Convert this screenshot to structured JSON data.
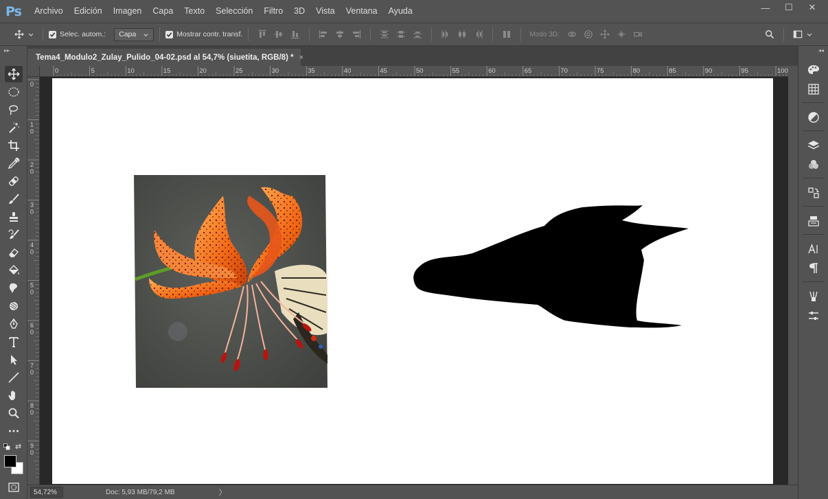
{
  "app": {
    "logo_text": "Ps"
  },
  "menu": {
    "items": [
      "Archivo",
      "Edición",
      "Imagen",
      "Capa",
      "Texto",
      "Selección",
      "Filtro",
      "3D",
      "Vista",
      "Ventana",
      "Ayuda"
    ]
  },
  "window_controls": {
    "minimize": "—",
    "maximize": "☐",
    "close": "✕"
  },
  "options_bar": {
    "auto_select_label": "Selec. autom.:",
    "auto_select_checked": true,
    "auto_select_target": "Capa",
    "show_transform_label": "Mostrar contr. transf.",
    "show_transform_checked": true,
    "mode_3d_label": "Modo 3D:"
  },
  "document_tab": {
    "title": "Tema4_Modulo2_Zulay_Pulido_04-02.psd al 54,7% (siuetita, RGB/8) *",
    "close": "×"
  },
  "ruler": {
    "horizontal_labels": [
      "0",
      "5",
      "10",
      "15",
      "20",
      "25",
      "30",
      "35",
      "40",
      "45",
      "50",
      "55",
      "60",
      "65",
      "70",
      "75",
      "80",
      "85",
      "90",
      "95",
      "100"
    ],
    "vertical_labels": [
      "0",
      "1\n0",
      "2\n0",
      "3\n0",
      "4\n0",
      "5\n0",
      "6\n0",
      "7\n0",
      "8\n0",
      "9\n0"
    ]
  },
  "toolbar": {
    "tools": [
      "move-tool-icon",
      "marquee-tool-icon",
      "lasso-tool-icon",
      "magic-wand-tool-icon",
      "crop-tool-icon",
      "eyedropper-tool-icon",
      "healing-brush-tool-icon",
      "brush-tool-icon",
      "clone-stamp-tool-icon",
      "history-brush-tool-icon",
      "eraser-tool-icon",
      "paint-bucket-tool-icon",
      "smudge-tool-icon",
      "dodge-tool-icon",
      "pen-tool-icon",
      "type-tool-icon",
      "path-selection-tool-icon",
      "line-tool-icon",
      "hand-tool-icon",
      "zoom-tool-icon",
      "more-tools-icon"
    ],
    "foreground_color": "#000000",
    "background_color": "#ffffff"
  },
  "right_dock": {
    "icons": [
      "swatches-palette-icon",
      "grid-icon",
      "adjustments-icon",
      "layers-icon",
      "channels-icon",
      "history-icon",
      "properties-icon",
      "character-icon",
      "paragraph-icon",
      "brush-presets-icon",
      "tool-presets-icon"
    ]
  },
  "status_bar": {
    "zoom": "54,72%",
    "doc_info": "Doc: 5,93 MB/79,2 MB",
    "arrow": "〉"
  },
  "colors": {
    "ui_background": "#535353",
    "pasteboard": "#282828",
    "artboard": "#ffffff",
    "ps_logo": "#7bb7ea"
  }
}
